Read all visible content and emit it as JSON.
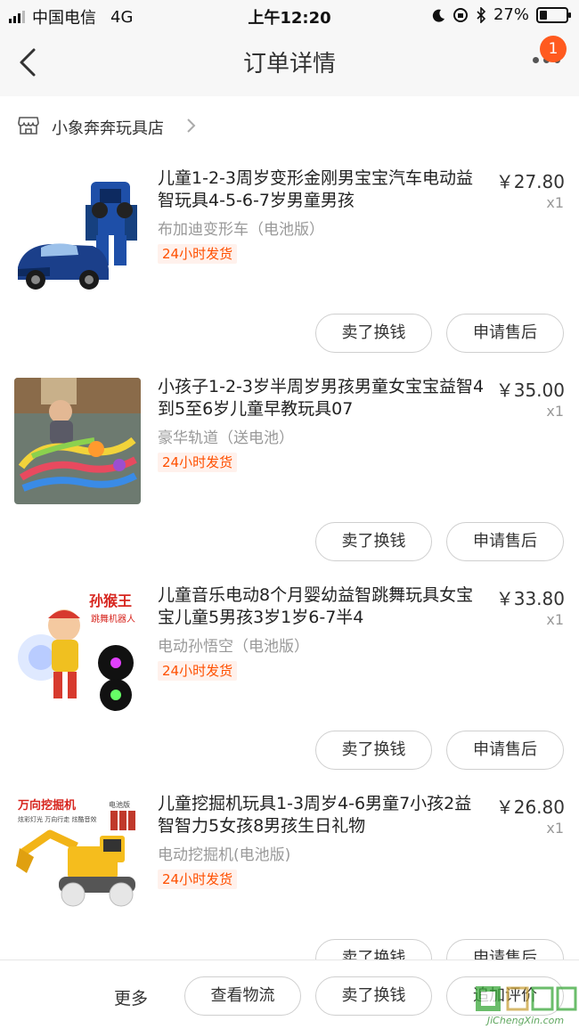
{
  "status_bar": {
    "carrier": "中国电信",
    "network": "4G",
    "time": "上午12:20",
    "battery": "27%",
    "battery_level": 0.27
  },
  "nav": {
    "title": "订单详情",
    "badge_count": "1"
  },
  "shop": {
    "name": "小象奔奔玩具店"
  },
  "items": [
    {
      "title": "儿童1-2-3周岁变形金刚男宝宝汽车电动益智玩具4-5-6-7岁男童男孩",
      "price": "￥27.80",
      "qty": "x1",
      "sku": "布加迪变形车（电池版）",
      "tag": "24小时发货",
      "btn_sell": "卖了换钱",
      "btn_after": "申请售后"
    },
    {
      "title": "小孩子1-2-3岁半周岁男孩男童女宝宝益智4到5至6岁儿童早教玩具07",
      "price": "￥35.00",
      "qty": "x1",
      "sku": "豪华轨道（送电池）",
      "tag": "24小时发货",
      "btn_sell": "卖了换钱",
      "btn_after": "申请售后"
    },
    {
      "title": "儿童音乐电动8个月婴幼益智跳舞玩具女宝宝儿童5男孩3岁1岁6-7半4",
      "price": "￥33.80",
      "qty": "x1",
      "sku": "电动孙悟空（电池版）",
      "tag": "24小时发货",
      "btn_sell": "卖了换钱",
      "btn_after": "申请售后",
      "img_text": {
        "brand": "孙猴王",
        "sub": "跳舞机器人"
      }
    },
    {
      "title": "儿童挖掘机玩具1-3周岁4-6男童7小孩2益智智力5女孩8男孩生日礼物",
      "price": "￥26.80",
      "qty": "x1",
      "sku": "电动挖掘机(电池版)",
      "tag": "24小时发货",
      "btn_sell": "卖了换钱",
      "btn_after": "申请售后",
      "img_text": {
        "brand": "万向挖掘机",
        "sub": "炫彩灯光 万向行走 炫酷音效",
        "battery": "电池版"
      }
    }
  ],
  "bottom_bar": {
    "more": "更多",
    "logistics": "查看物流",
    "sell": "卖了换钱",
    "review": "追加评价"
  },
  "watermark": {
    "text": "JiChengXin.com"
  },
  "colors": {
    "accent": "#ff5000",
    "badge": "#ff5a1f",
    "tag_bg": "#fff1ec",
    "header_bg": "#f7f7f7"
  }
}
